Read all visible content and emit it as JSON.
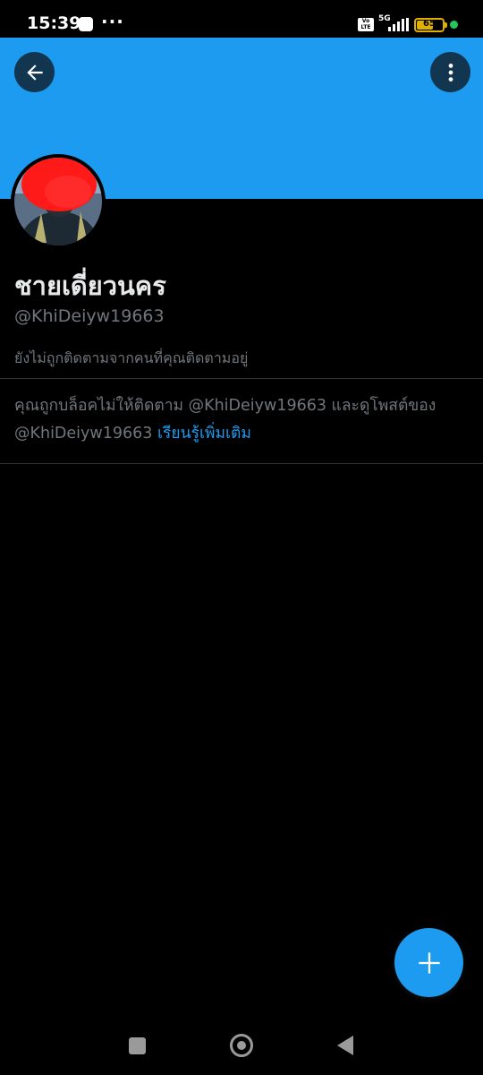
{
  "status_bar": {
    "time": "15:39",
    "dots": "···",
    "volte": "Vo LTE",
    "network": "5G",
    "battery_level": "65",
    "active_dot_color": "#22c55e"
  },
  "colors": {
    "banner": "#1d9bf0",
    "accent": "#1d9bf0",
    "background": "#000000"
  },
  "header": {
    "back_icon": "arrow-left-icon",
    "more_icon": "vertical-dots-icon"
  },
  "profile": {
    "display_name": "ชายเดี่ยวนคร",
    "handle": "@KhiDeiyw19663",
    "followed_by_text": "ยังไม่ถูกติดตามจากคนที่คุณติดตามอยู่"
  },
  "blocked_notice": {
    "message": "คุณถูกบล็อคไม่ให้ติดตาม @KhiDeiyw19663 และดูโพสต์ของ @KhiDeiyw19663",
    "learn_more": "เรียนรู้เพิ่มเติม"
  },
  "fab": {
    "icon": "plus-icon"
  },
  "nav_bar": {
    "recents_icon": "square-icon",
    "home_icon": "circle-icon",
    "back_icon": "triangle-back-icon"
  }
}
